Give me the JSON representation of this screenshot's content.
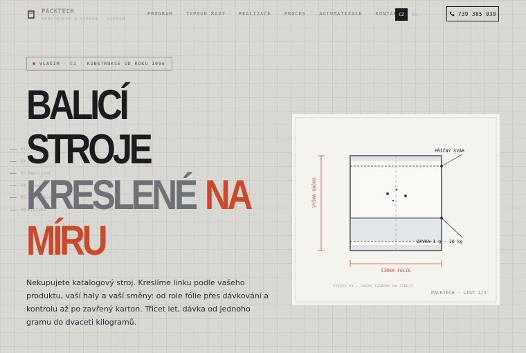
{
  "brand": {
    "name": "PACKTECH",
    "subtitle": "KONSTRUKCE A VÝROBA · VLAŠIM"
  },
  "nav": {
    "items": [
      "PROGRAM",
      "TYPOVÉ ŘADY",
      "REALIZACE",
      "PROCES",
      "AUTOMATIZACE",
      "KONTAKT"
    ]
  },
  "lang": {
    "active": "CZ",
    "other": "EN"
  },
  "phone": {
    "number": "739 385 030"
  },
  "tag": {
    "text": "VLAŠIM · CZ · KONSTRUKCE OD ROKU 1996"
  },
  "headline": {
    "line1": "BALICÍ",
    "line2": "STROJE",
    "line3a": "KRESLENÉ",
    "line3b": "NA",
    "line4": "MÍRU"
  },
  "side_index": [
    "01 Program",
    "02 Řady",
    "03 Realizace",
    "04 Proces",
    "05 Automatizace",
    "06 Kontakt"
  ],
  "intro": {
    "text": "Nekupujete katalogový stroj. Kreslíme linku podle vašeho produktu, vaší haly a vaší směny: od role fólie přes dávkování a kontrolu až po zavřený karton. Třicet let, dávka od jednoho gramu do dvaceti kilogramů."
  },
  "drawing": {
    "label_transverse_seal": "PŘÍČNÝ SVÁR",
    "label_dose": "DÁVKA 1 g — 20 kg",
    "label_bag_height": "VÝŠKA SÁČKU",
    "label_foil_width": "ŠÍŘKA FÓLIE",
    "caption": "VÝKRES 01 — SÁČEK TVOŘENÝ NA STROJI",
    "sheet": "PACKTECH · LIST 1/1"
  },
  "colors": {
    "accent": "#c94a2b",
    "ink": "#1a1c20",
    "navy": "#2f4a66",
    "background": "#d9d7d2"
  }
}
